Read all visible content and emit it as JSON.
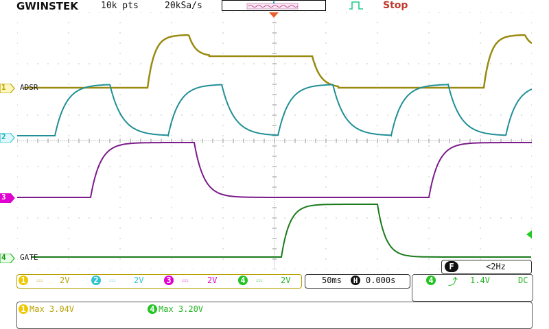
{
  "header": {
    "brand": "GWINSTEK",
    "record_length": "10k pts",
    "sample_rate": "20kSa/s",
    "run_state": "Stop"
  },
  "channels": [
    {
      "id": "1",
      "label": "ADSR",
      "color": "#b9a000",
      "trace_color": "#9a8a10",
      "scale": "2V"
    },
    {
      "id": "2",
      "label": "",
      "color": "#2fc4d2",
      "trace_color": "#1f8f96",
      "scale": "2V"
    },
    {
      "id": "3",
      "label": "",
      "color": "#e000d0",
      "trace_color": "#7b1a8a",
      "scale": "2V"
    },
    {
      "id": "4",
      "label": "GATE",
      "color": "#22b422",
      "trace_color": "#1a7a1a",
      "scale": "2V"
    }
  ],
  "timebase": {
    "scale": "50ms",
    "h_symbol": "H",
    "position": "0.000s"
  },
  "trigger": {
    "source": "4",
    "slope_symbol": "⤴",
    "level": "1.4V",
    "coupling": "DC",
    "freq_badge": "F",
    "freq": "<2Hz"
  },
  "measurements": [
    {
      "ch": "1",
      "text": "Max 3.04V"
    },
    {
      "ch": "4",
      "text": "Max 3.20V"
    }
  ],
  "colors": {
    "grid": "#8a8a8a",
    "trigger_marker": "#e8602a"
  },
  "icons": {
    "trigger_state": "pulse-edge-icon",
    "slope": "rising-edge-icon"
  }
}
